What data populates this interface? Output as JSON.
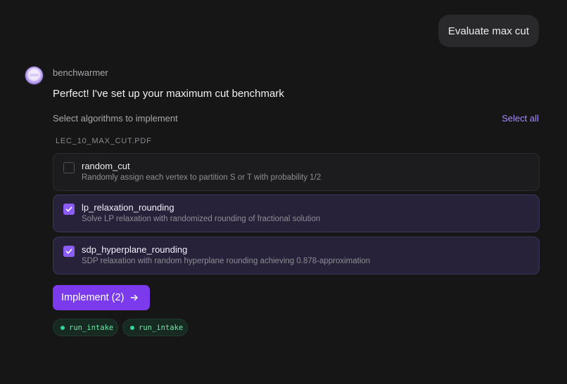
{
  "user_message": "Evaluate max cut",
  "bot": {
    "name": "benchwarmer",
    "message": "Perfect! I've set up your maximum cut benchmark"
  },
  "algorithms": {
    "section_label": "Select algorithms to implement",
    "select_all_label": "Select all",
    "source_label": "LEC_10_MAX_CUT.PDF",
    "options": [
      {
        "title": "random_cut",
        "description": "Randomly assign each vertex to partition S or T with probability 1/2",
        "checked": false
      },
      {
        "title": "lp_relaxation_rounding",
        "description": "Solve LP relaxation with randomized rounding of fractional solution",
        "checked": true
      },
      {
        "title": "sdp_hyperplane_rounding",
        "description": "SDP relaxation with random hyperplane rounding achieving 0.878-approximation",
        "checked": true
      }
    ]
  },
  "implement_button": {
    "label": "Implement (2)",
    "icon": "arrow-right-icon"
  },
  "tool_calls": [
    {
      "label": "run_intake",
      "status_color": "#34d399"
    },
    {
      "label": "run_intake",
      "status_color": "#34d399"
    }
  ],
  "colors": {
    "accent": "#7c3aed",
    "link": "#a78bfa",
    "background": "#161617"
  }
}
